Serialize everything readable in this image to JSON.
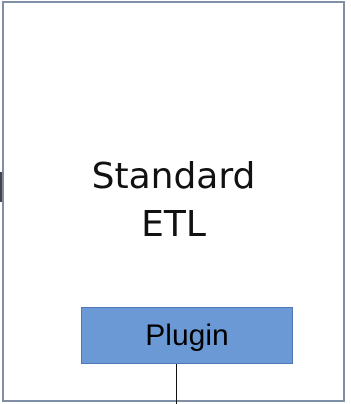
{
  "diagram": {
    "main_node": {
      "label": "Standard\nETL"
    },
    "child_node": {
      "label": "Plugin"
    }
  },
  "colors": {
    "main_border": "#7f8fa6",
    "plugin_fill": "#6b99d6",
    "plugin_border": "#4f78b6"
  }
}
